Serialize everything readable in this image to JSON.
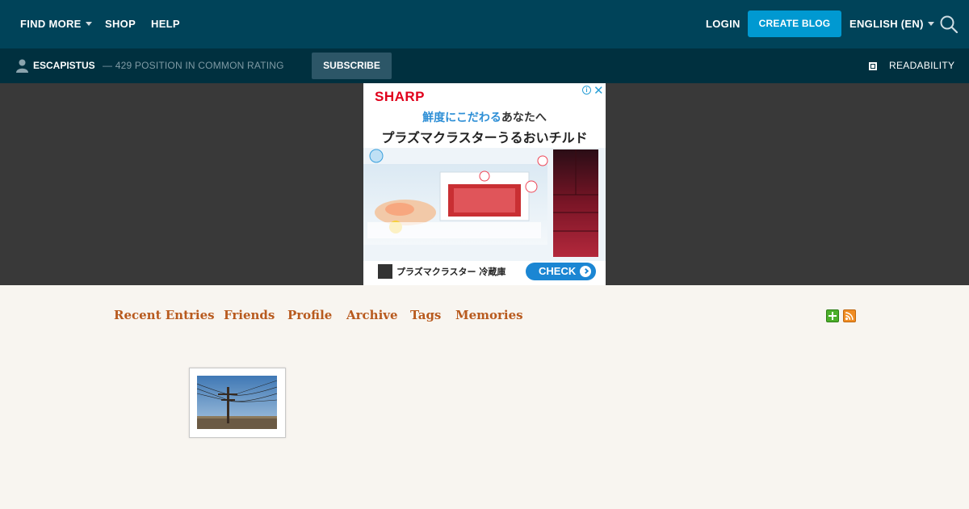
{
  "topbar": {
    "find_more": "FIND MORE",
    "shop": "SHOP",
    "help": "HELP",
    "login": "LOGIN",
    "create_blog": "CREATE BLOG",
    "language": "ENGLISH (EN)"
  },
  "subbar": {
    "username": "ESCAPISTUS",
    "rating": "— 429 POSITION IN COMMON RATING",
    "subscribe": "SUBSCRIBE",
    "readability": "READABILITY"
  },
  "ad": {
    "brand": "SHARP",
    "info": "i",
    "close": "✕",
    "line1_highlight": "鮮度にこだわる",
    "line1_rest": "あなたへ",
    "line2": "プラズマクラスターうるおいチルド",
    "footer": "プラズマクラスター 冷蔵庫",
    "cta": "CHECK"
  },
  "journal_nav": {
    "items": [
      "Recent Entries",
      "Friends",
      "Profile",
      "Archive",
      "Tags",
      "Memories"
    ]
  },
  "colors": {
    "topbar": "#004359",
    "subbar": "#00303f",
    "accent": "#0099d1",
    "link": "#b85a1e",
    "page_bg": "#f8f5f0"
  }
}
